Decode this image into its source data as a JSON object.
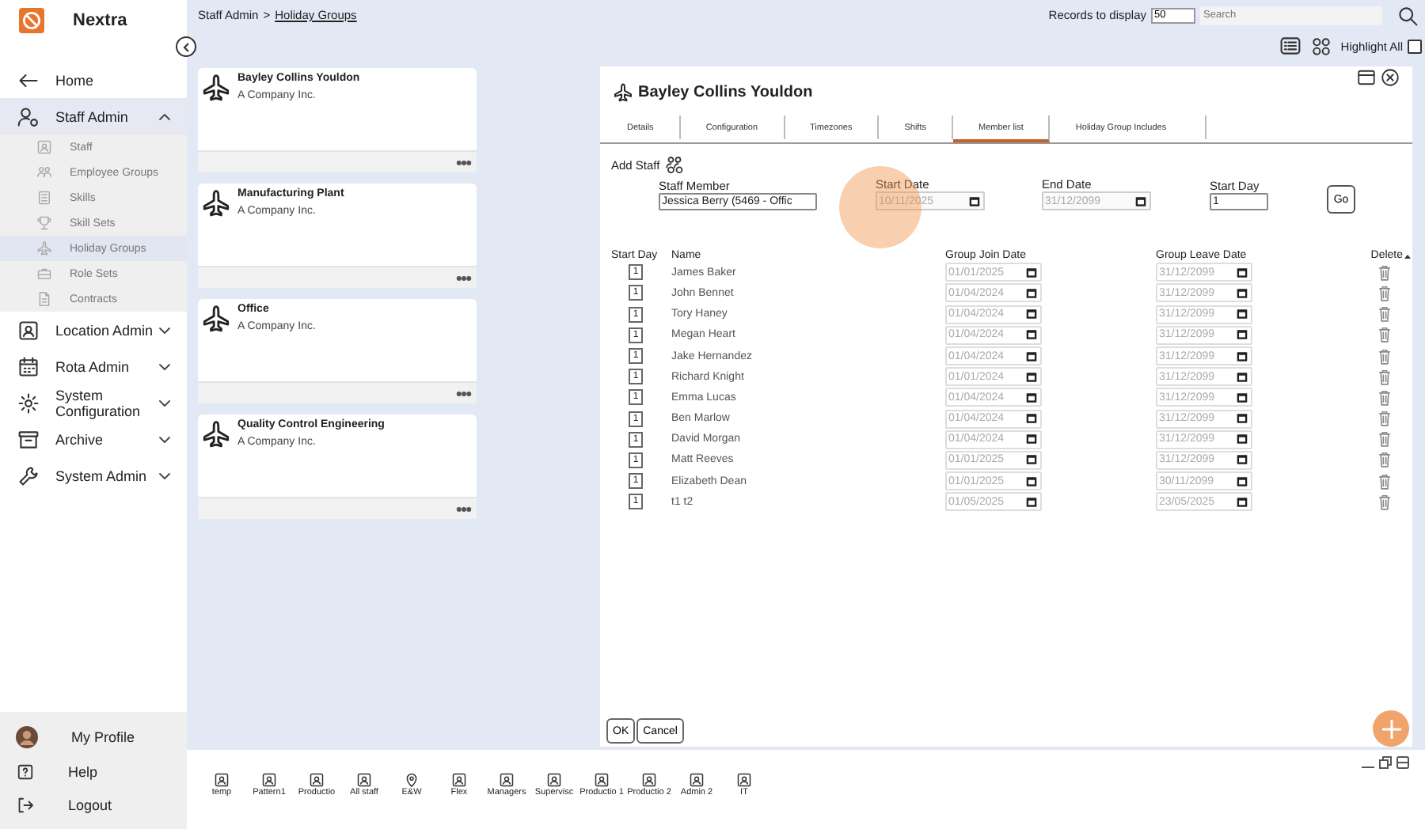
{
  "app": {
    "name": "Nextra"
  },
  "sidebar": {
    "items": [
      {
        "label": "Home",
        "kind": "link",
        "selected": false
      },
      {
        "label": "Staff Admin",
        "kind": "group",
        "selected": true,
        "expanded": true,
        "children": [
          {
            "label": "Staff",
            "selected": false
          },
          {
            "label": "Employee Groups",
            "selected": false
          },
          {
            "label": "Skills",
            "selected": false
          },
          {
            "label": "Skill Sets",
            "selected": false
          },
          {
            "label": "Holiday Groups",
            "selected": true
          },
          {
            "label": "Role Sets",
            "selected": false
          },
          {
            "label": "Contracts",
            "selected": false
          }
        ]
      },
      {
        "label": "Location Admin",
        "kind": "group",
        "selected": false,
        "expanded": false
      },
      {
        "label": "Rota Admin",
        "kind": "group",
        "selected": false,
        "expanded": false
      },
      {
        "label": "System Configuration",
        "kind": "group",
        "selected": false,
        "expanded": false
      },
      {
        "label": "Archive",
        "kind": "group",
        "selected": false,
        "expanded": false
      },
      {
        "label": "System Admin",
        "kind": "group",
        "selected": false,
        "expanded": false
      }
    ],
    "footer": [
      "My Profile",
      "Help",
      "Logout"
    ]
  },
  "breadcrumb": [
    {
      "label": "Staff Admin",
      "link": false
    },
    {
      "label": ">",
      "link": false
    },
    {
      "label": "Holiday Groups",
      "link": true
    }
  ],
  "toolbar": {
    "records_label": "Records to display",
    "records_value": "50",
    "search_placeholder": "Search",
    "highlight_all": {
      "label": "Highlight All",
      "checked": false
    }
  },
  "cards": [
    {
      "title": "Bayley Collins Youldon",
      "subtitle": "A Company Inc."
    },
    {
      "title": "Manufacturing Plant",
      "subtitle": "A Company Inc."
    },
    {
      "title": "Office",
      "subtitle": "A Company Inc."
    },
    {
      "title": "Quality Control Engineering",
      "subtitle": "A Company Inc."
    }
  ],
  "dialog": {
    "title": "Bayley Collins Youldon",
    "tabs": [
      {
        "label": "Details",
        "selected": false
      },
      {
        "label": "Configuration",
        "selected": false
      },
      {
        "label": "Timezones",
        "selected": false
      },
      {
        "label": "Shifts",
        "selected": false
      },
      {
        "label": "Member list",
        "selected": true
      },
      {
        "label": "Holiday Group Includes",
        "selected": false
      }
    ],
    "add_staff": {
      "label": "Add Staff",
      "fields": [
        {
          "label": "Staff Member",
          "value": "Jessica Berry (5469 - Offic",
          "kind": "text",
          "disabled": false
        },
        {
          "label": "Start Date",
          "value": "10/11/2025",
          "kind": "date",
          "disabled": true
        },
        {
          "label": "End Date",
          "value": "31/12/2099",
          "kind": "date",
          "disabled": true
        },
        {
          "label": "Start Day",
          "value": "1",
          "kind": "text",
          "disabled": false
        }
      ],
      "go": "Go"
    },
    "columns": [
      "Start Day",
      "Name",
      "Group Join Date",
      "Group Leave Date",
      "Delete"
    ],
    "rows": [
      {
        "start_day": "1",
        "name": "James Baker",
        "join": "01/01/2025",
        "leave": "31/12/2099"
      },
      {
        "start_day": "1",
        "name": "John Bennet",
        "join": "01/04/2024",
        "leave": "31/12/2099"
      },
      {
        "start_day": "1",
        "name": "Tory Haney",
        "join": "01/04/2024",
        "leave": "31/12/2099"
      },
      {
        "start_day": "1",
        "name": "Megan Heart",
        "join": "01/04/2024",
        "leave": "31/12/2099"
      },
      {
        "start_day": "1",
        "name": "Jake Hernandez",
        "join": "01/04/2024",
        "leave": "31/12/2099"
      },
      {
        "start_day": "1",
        "name": "Richard Knight",
        "join": "01/01/2024",
        "leave": "31/12/2099"
      },
      {
        "start_day": "1",
        "name": "Emma Lucas",
        "join": "01/04/2024",
        "leave": "31/12/2099"
      },
      {
        "start_day": "1",
        "name": "Ben Marlow",
        "join": "01/04/2024",
        "leave": "31/12/2099"
      },
      {
        "start_day": "1",
        "name": "David Morgan",
        "join": "01/04/2024",
        "leave": "31/12/2099"
      },
      {
        "start_day": "1",
        "name": "Matt Reeves",
        "join": "01/01/2025",
        "leave": "31/12/2099"
      },
      {
        "start_day": "1",
        "name": "Elizabeth Dean",
        "join": "01/01/2025",
        "leave": "30/11/2099"
      },
      {
        "start_day": "1",
        "name": "t1 t2",
        "join": "01/05/2025",
        "leave": "23/05/2025"
      }
    ],
    "buttons": [
      "OK",
      "Cancel"
    ]
  },
  "taskbar": [
    {
      "label": "temp",
      "kind": "group"
    },
    {
      "label": "Pattern1",
      "kind": "group"
    },
    {
      "label": "Productio",
      "kind": "group"
    },
    {
      "label": "All staff",
      "kind": "group"
    },
    {
      "label": "E&W",
      "kind": "location"
    },
    {
      "label": "Flex",
      "kind": "group"
    },
    {
      "label": "Managers",
      "kind": "group"
    },
    {
      "label": "Supervisc",
      "kind": "group"
    },
    {
      "label": "Productio 1",
      "kind": "group"
    },
    {
      "label": "Productio 2",
      "kind": "group"
    },
    {
      "label": "Admin 2",
      "kind": "group"
    },
    {
      "label": "IT",
      "kind": "group"
    }
  ]
}
